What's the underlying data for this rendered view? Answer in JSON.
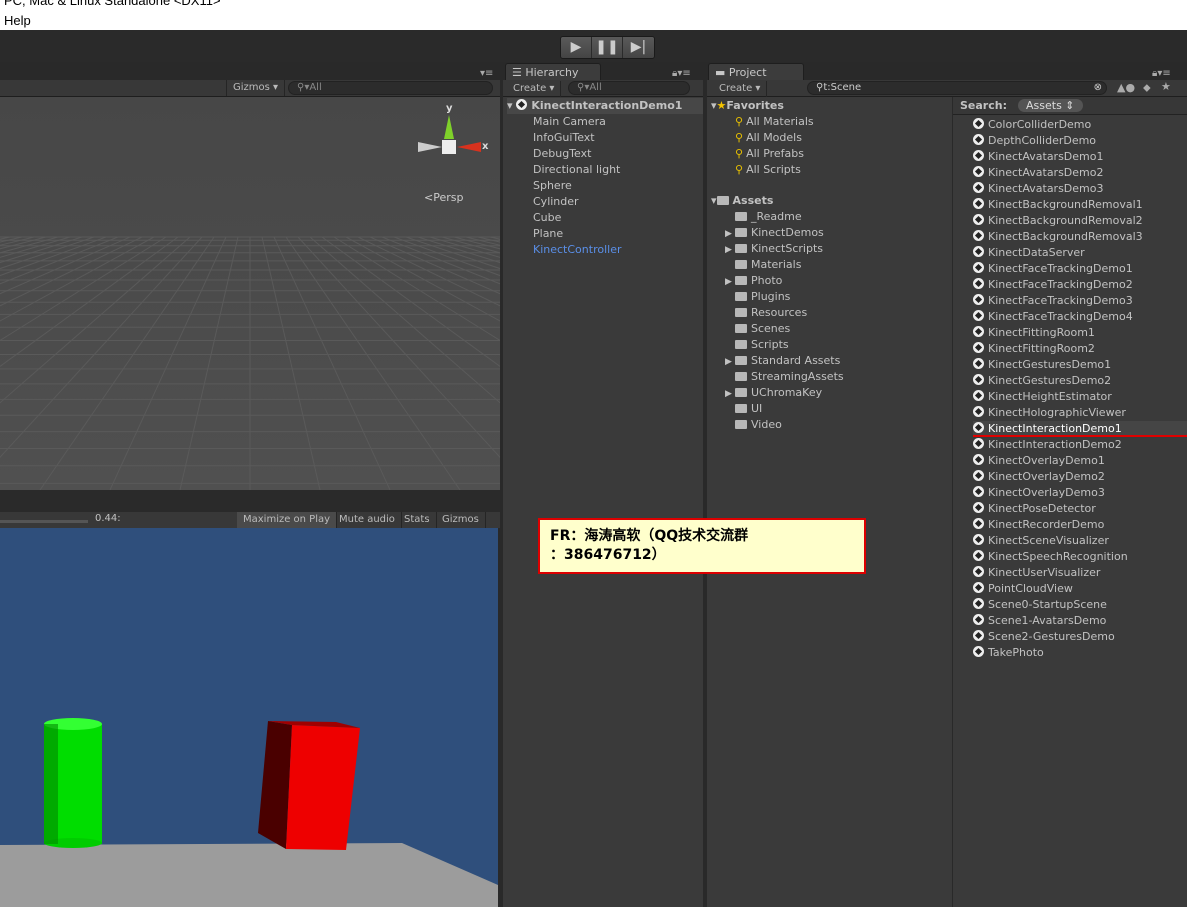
{
  "window": {
    "title": "PC, Mac & Linux Standalone <DX11>",
    "menu_help": "Help"
  },
  "play": {
    "play_icon": "play-icon",
    "pause_icon": "pause-icon",
    "step_icon": "step-icon"
  },
  "scene": {
    "gizmos": "Gizmos",
    "search_placeholder": "All",
    "persp": "Persp",
    "axis_y": "y",
    "axis_x": "x"
  },
  "game": {
    "scale_value": "0.44:",
    "buttons": [
      "Maximize on Play",
      "Mute audio",
      "Stats",
      "Gizmos"
    ],
    "sky_color": "#2f4f7c"
  },
  "hierarchy": {
    "tab": "Hierarchy",
    "create": "Create",
    "search_placeholder": "All",
    "scene_name": "KinectInteractionDemo1",
    "items": [
      "Main Camera",
      "InfoGuiText",
      "DebugText",
      "Directional light",
      "Sphere",
      "Cylinder",
      "Cube",
      "Plane",
      "KinectController"
    ]
  },
  "project": {
    "tab": "Project",
    "create": "Create",
    "search_value": "t:Scene",
    "favorites_label": "Favorites",
    "favorites": [
      "All Materials",
      "All Models",
      "All Prefabs",
      "All Scripts"
    ],
    "assets_label": "Assets",
    "assets": [
      {
        "name": "_Readme",
        "expandable": false
      },
      {
        "name": "KinectDemos",
        "expandable": true
      },
      {
        "name": "KinectScripts",
        "expandable": true
      },
      {
        "name": "Materials",
        "expandable": false
      },
      {
        "name": "Photo",
        "expandable": true
      },
      {
        "name": "Plugins",
        "expandable": false
      },
      {
        "name": "Resources",
        "expandable": false
      },
      {
        "name": "Scenes",
        "expandable": false
      },
      {
        "name": "Scripts",
        "expandable": false
      },
      {
        "name": "Standard Assets",
        "expandable": true
      },
      {
        "name": "StreamingAssets",
        "expandable": false
      },
      {
        "name": "UChromaKey",
        "expandable": true
      },
      {
        "name": "UI",
        "expandable": false
      },
      {
        "name": "Video",
        "expandable": false
      }
    ],
    "search_label": "Search:",
    "search_scope": "Assets",
    "results": [
      "ColorColliderDemo",
      "DepthColliderDemo",
      "KinectAvatarsDemo1",
      "KinectAvatarsDemo2",
      "KinectAvatarsDemo3",
      "KinectBackgroundRemoval1",
      "KinectBackgroundRemoval2",
      "KinectBackgroundRemoval3",
      "KinectDataServer",
      "KinectFaceTrackingDemo1",
      "KinectFaceTrackingDemo2",
      "KinectFaceTrackingDemo3",
      "KinectFaceTrackingDemo4",
      "KinectFittingRoom1",
      "KinectFittingRoom2",
      "KinectGesturesDemo1",
      "KinectGesturesDemo2",
      "KinectHeightEstimator",
      "KinectHolographicViewer",
      "KinectInteractionDemo1",
      "KinectInteractionDemo2",
      "KinectOverlayDemo1",
      "KinectOverlayDemo2",
      "KinectOverlayDemo3",
      "KinectPoseDetector",
      "KinectRecorderDemo",
      "KinectSceneVisualizer",
      "KinectSpeechRecognition",
      "KinectUserVisualizer",
      "PointCloudView",
      "Scene0-StartupScene",
      "Scene1-AvatarsDemo",
      "Scene2-GesturesDemo",
      "TakePhoto"
    ],
    "highlighted": "KinectInteractionDemo1"
  },
  "annotation": {
    "line1": "FR：海涛高软（QQ技术交流群",
    "line2": "：386476712）"
  }
}
